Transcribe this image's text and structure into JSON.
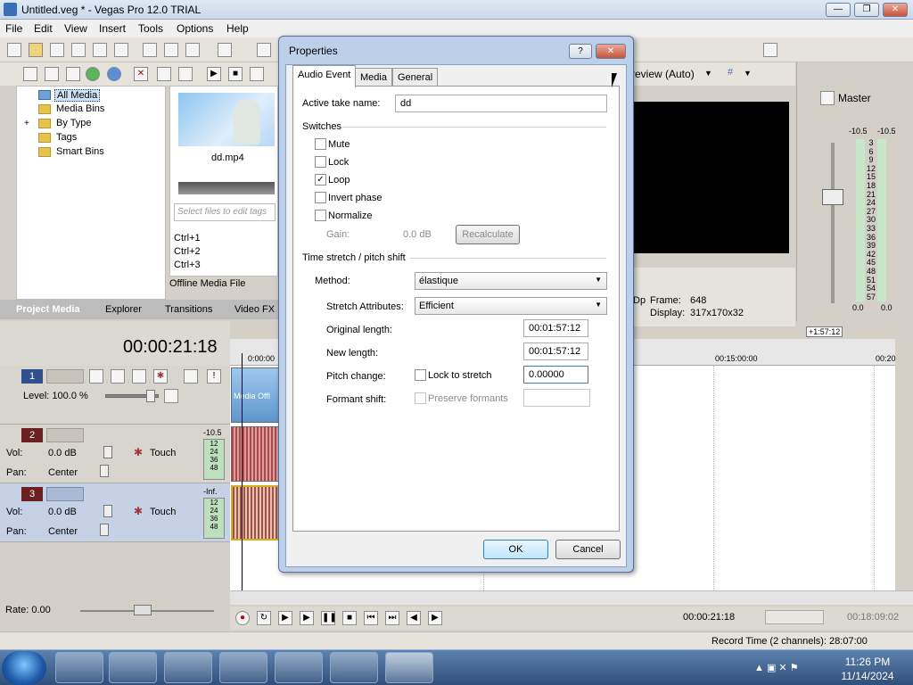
{
  "window": {
    "title": "Untitled.veg * - Vegas Pro 12.0 TRIAL",
    "min": "—",
    "max": "❐",
    "close": "✕"
  },
  "menu": [
    "File",
    "Edit",
    "View",
    "Insert",
    "Tools",
    "Options",
    "Help"
  ],
  "media_tree": {
    "items": [
      "All Media",
      "Media Bins",
      "By Type",
      "Tags",
      "Smart Bins"
    ],
    "expand": "+"
  },
  "media_file": {
    "name": "dd.mp4",
    "filter_placeholder": "Select files to edit tags",
    "shortcuts": [
      "Ctrl+1",
      "Ctrl+2",
      "Ctrl+3"
    ],
    "offline_label": "Offline Media File"
  },
  "bottom_tabs": [
    "Project Media",
    "Explorer",
    "Transitions",
    "Video FX"
  ],
  "timeline": {
    "time": "00:00:21:18",
    "ruler": [
      "0:00:00",
      "00:15:00:00",
      "00:20"
    ],
    "end_marker": "+1:57:12",
    "tracks": [
      {
        "num": "1",
        "level": "Level: 100.0 %"
      },
      {
        "num": "2",
        "vol": "Vol:",
        "vol_val": "0.0 dB",
        "pan": "Pan:",
        "pan_val": "Center",
        "mode": "Touch",
        "meter_top": "-10.5",
        "meter": [
          "12",
          "24",
          "36",
          "48"
        ]
      },
      {
        "num": "3",
        "vol": "Vol:",
        "vol_val": "0.0 dB",
        "pan": "Pan:",
        "pan_val": "Center",
        "mode": "Touch",
        "meter_top": "-Inf.",
        "meter": [
          "12",
          "24",
          "36",
          "48"
        ]
      }
    ],
    "clip_label": "Media Offl"
  },
  "preview": {
    "label": "review (Auto)",
    "frame_label": "Frame:",
    "frame_value": "648",
    "display_label": "Display:",
    "display_value": "317x170x32",
    "cut_label": "Dp"
  },
  "master": {
    "label": "Master",
    "left": "-10.5",
    "right": "-10.5",
    "scale": [
      "3",
      "6",
      "9",
      "12",
      "15",
      "18",
      "21",
      "24",
      "27",
      "30",
      "33",
      "36",
      "39",
      "42",
      "45",
      "48",
      "51",
      "54",
      "57"
    ],
    "bottom_left": "0.0",
    "bottom_right": "0.0"
  },
  "transport": {
    "time": "00:00:21:18",
    "end_time": "00:18:09:02"
  },
  "rate": "Rate: 0.00",
  "status": "Record Time (2 channels): 28:07:00",
  "clock": {
    "time": "11:26 PM",
    "date": "11/14/2024"
  },
  "dialog": {
    "title": "Properties",
    "help": "?",
    "close": "✕",
    "tabs": [
      "Audio Event",
      "Media",
      "General"
    ],
    "active_take_label": "Active take name:",
    "active_take_value": "dd",
    "switches_label": "Switches",
    "switches": [
      {
        "label": "Mute",
        "checked": false
      },
      {
        "label": "Lock",
        "checked": false
      },
      {
        "label": "Loop",
        "checked": true
      },
      {
        "label": "Invert phase",
        "checked": false
      },
      {
        "label": "Normalize",
        "checked": false
      }
    ],
    "check_mark": "✓",
    "gain_label": "Gain:",
    "gain_value": "0.0 dB",
    "recalculate": "Recalculate",
    "stretch_group": "Time stretch / pitch shift",
    "method_label": "Method:",
    "method_value": "élastique",
    "stretch_attr_label": "Stretch Attributes:",
    "stretch_attr_value": "Efficient",
    "original_length_label": "Original length:",
    "original_length_value": "00:01:57:12",
    "new_length_label": "New length:",
    "new_length_value": "00:01:57:12",
    "pitch_label": "Pitch change:",
    "lock_to_stretch": "Lock to stretch",
    "pitch_value": "0.00000",
    "formant_label": "Formant shift:",
    "preserve_formants": "Preserve formants",
    "ok": "OK",
    "cancel": "Cancel"
  }
}
